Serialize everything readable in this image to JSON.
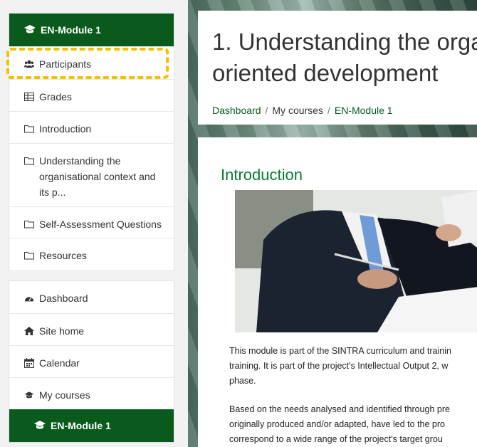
{
  "sidebar": {
    "course_header": "EN-Module 1",
    "course_items": [
      {
        "label": "Participants",
        "icon": "users-icon"
      },
      {
        "label": "Grades",
        "icon": "table-icon"
      },
      {
        "label": "Introduction",
        "icon": "folder-icon"
      },
      {
        "label": "Understanding the organisational context and its p...",
        "icon": "folder-icon"
      },
      {
        "label": "Self-Assessment Questions",
        "icon": "folder-icon"
      },
      {
        "label": "Resources",
        "icon": "folder-icon"
      }
    ],
    "site_items": [
      {
        "label": "Dashboard",
        "icon": "dashboard-icon"
      },
      {
        "label": "Site home",
        "icon": "home-icon"
      },
      {
        "label": "Calendar",
        "icon": "calendar-icon"
      },
      {
        "label": "My courses",
        "icon": "graduation-cap-icon"
      }
    ],
    "active_course": "EN-Module 1"
  },
  "header": {
    "title_line1": "1. Understanding the orga",
    "title_line2": "oriented development",
    "breadcrumb": [
      "Dashboard",
      "My courses",
      "EN-Module 1"
    ]
  },
  "content": {
    "section_title": "Introduction",
    "para1_l1": "This module is part of the SINTRA curriculum and trainin",
    "para1_l2": "training. It is part of the project's Intellectual Output 2, w",
    "para1_l3": "phase.",
    "para2_l1": "Based on the needs analysed and identified through pre",
    "para2_l2": "originally produced and/or adapted, have led to the pro",
    "para2_l3": "correspond to a wide range of the project's target grou"
  },
  "colors": {
    "brand_green": "#0a5a1e",
    "link_green": "#0a7a32",
    "highlight": "#f5c000"
  }
}
